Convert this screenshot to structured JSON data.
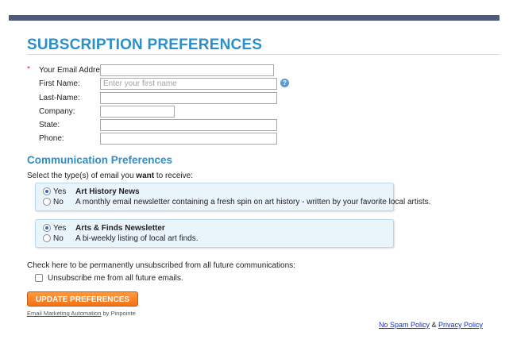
{
  "header": {
    "title": "SUBSCRIPTION PREFERENCES"
  },
  "form": {
    "required_marker": "*",
    "help_symbol": "?",
    "fields": [
      {
        "label": "Your Email Address:",
        "value": "",
        "placeholder": ""
      },
      {
        "label": "First Name:",
        "value": "",
        "placeholder": "Enter your first name"
      },
      {
        "label": "Last-Name:",
        "value": "",
        "placeholder": ""
      },
      {
        "label": "Company:",
        "value": "",
        "placeholder": ""
      },
      {
        "label": "State:",
        "value": "",
        "placeholder": ""
      },
      {
        "label": "Phone:",
        "value": "",
        "placeholder": ""
      }
    ]
  },
  "communication": {
    "title": "Communication Preferences",
    "intro_before": "Select the type(s) of email you ",
    "intro_bold": "want",
    "intro_after": " to receive:",
    "options": [
      {
        "name": "Art History News",
        "description": "A monthly email newsletter containing a fresh spin on art history - written by your favorite local artists.",
        "yes_label": "Yes",
        "no_label": "No",
        "selected": "Yes"
      },
      {
        "name": "Arts & Finds Newsletter",
        "description": "A bi-weekly listing of local art finds.",
        "yes_label": "Yes",
        "no_label": "No",
        "selected": "Yes"
      }
    ]
  },
  "unsubscribe": {
    "text": "Check here to be permanently unsubscribed from all future communications:",
    "checkbox_label": "Unsubscribe me from all future emails.",
    "checked": false
  },
  "update_button": {
    "label": "UPDATE PREFERENCES"
  },
  "powered_by": {
    "link_text": "Email Marketing Automation",
    "suffix": " by Pinpointe"
  },
  "footer": {
    "no_spam": "No Spam Policy",
    "separator": " & ",
    "privacy": "Privacy Policy"
  },
  "colors": {
    "accent": "#2b8fcb",
    "bar": "#4f5b7d",
    "button": "#f27214",
    "link": "#1a2fc9"
  }
}
